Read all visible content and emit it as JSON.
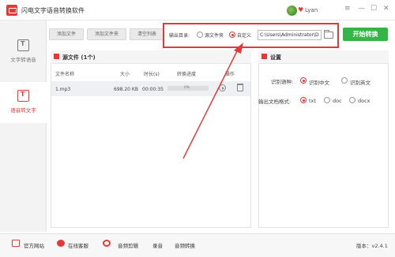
{
  "app": {
    "title": "闪电文字语音转换软件",
    "username": "Lyan"
  },
  "window": {
    "minimize": "—",
    "maximize": "☐",
    "close": "✕",
    "menu": "≡"
  },
  "sidebar": {
    "items": [
      {
        "label": "文字转语音",
        "active": false
      },
      {
        "label": "语音转文字",
        "active": true
      }
    ]
  },
  "toolbar": {
    "add_file": "添加文件",
    "add_folder": "添加文件夹",
    "clear_list": "清空列表"
  },
  "output": {
    "label": "输出目录:",
    "options": [
      {
        "label": "源文件夹",
        "selected": false
      },
      {
        "label": "自定义",
        "selected": true
      }
    ],
    "path": "C:\\Users\\Administrator\\De",
    "start_button": "开始转换"
  },
  "file_panel": {
    "title": "源文件 (1个)",
    "columns": [
      "文件名称",
      "大小",
      "时长(s)",
      "转换进度",
      "操作"
    ],
    "rows": [
      {
        "name": "1.mp3",
        "size": "698.20 KB",
        "duration": "00:00:35",
        "progress": 0,
        "progress_label": "0%"
      }
    ]
  },
  "settings": {
    "title": "设置",
    "language_label": "识别语种:",
    "language_options": [
      {
        "label": "识别中文",
        "selected": true
      },
      {
        "label": "识别英文",
        "selected": false
      }
    ],
    "format_label": "输出文档格式:",
    "format_options": [
      {
        "label": "txt",
        "selected": true
      },
      {
        "label": "doc",
        "selected": false
      },
      {
        "label": "docx",
        "selected": false
      }
    ]
  },
  "footer": {
    "links": [
      "官方网站",
      "在线客服",
      "音频剪辑",
      "录音",
      "音频转换"
    ],
    "version": "版本：v2.4.1"
  },
  "colors": {
    "accent": "#e53935",
    "start_button": "#35b546"
  }
}
